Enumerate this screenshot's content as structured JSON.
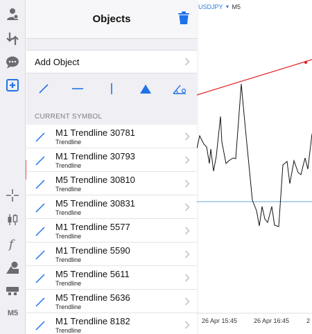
{
  "panel": {
    "title": "Objects",
    "add_object_label": "Add Object",
    "section_label": "CURRENT SYMBOL",
    "tools": [
      "trendline-tool",
      "horizontal-line-tool",
      "vertical-line-tool",
      "shape-tool",
      "fibonacci-tool"
    ]
  },
  "objects": [
    {
      "name": "M1 Trendline 30781",
      "type": "Trendline"
    },
    {
      "name": "M1 Trendline 30793",
      "type": "Trendline"
    },
    {
      "name": "M5 Trendline 30810",
      "type": "Trendline"
    },
    {
      "name": "M5 Trendline 30831",
      "type": "Trendline"
    },
    {
      "name": "M1 Trendline 5577",
      "type": "Trendline"
    },
    {
      "name": "M1 Trendline 5590",
      "type": "Trendline"
    },
    {
      "name": "M5 Trendline 5611",
      "type": "Trendline"
    },
    {
      "name": "M5 Trendline 5636",
      "type": "Trendline"
    },
    {
      "name": "M1 Trendline 8182",
      "type": "Trendline"
    }
  ],
  "toolbar": {
    "timeframe_label": "M5"
  },
  "chart": {
    "symbol": "USDJPY",
    "timeframe": "M5",
    "time_labels": [
      "26 Apr 15:45",
      "26 Apr 16:45",
      "2"
    ],
    "colors": {
      "trendline": "#e02020",
      "price": "#111111",
      "level": "#6aa5d8"
    }
  },
  "colors": {
    "accent": "#1f73e8"
  }
}
